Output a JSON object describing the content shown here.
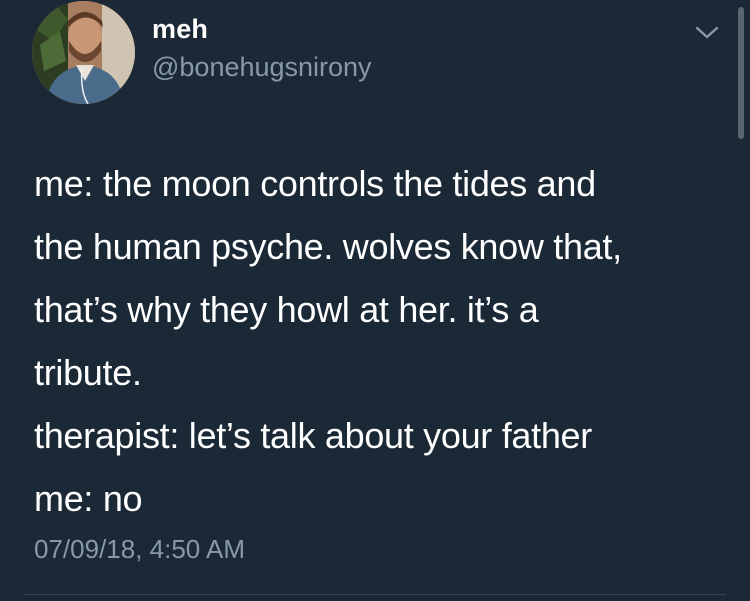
{
  "user": {
    "display_name": "meh",
    "handle": "@bonehugsnirony",
    "avatar_icon": "profile-photo"
  },
  "tweet": {
    "lines": [
      "me: the moon controls the tides and",
      "the human psyche. wolves know that,",
      "that’s why they howl at her. it’s a",
      "tribute.",
      "therapist: let’s talk about your father",
      "me: no"
    ],
    "timestamp": "07/09/18, 4:50 AM"
  },
  "menu": {
    "icon": "chevron-down-icon"
  },
  "colors": {
    "background": "#1b2836",
    "primary_text": "#ffffff",
    "secondary_text": "#8899a6",
    "divider": "#38444d"
  }
}
